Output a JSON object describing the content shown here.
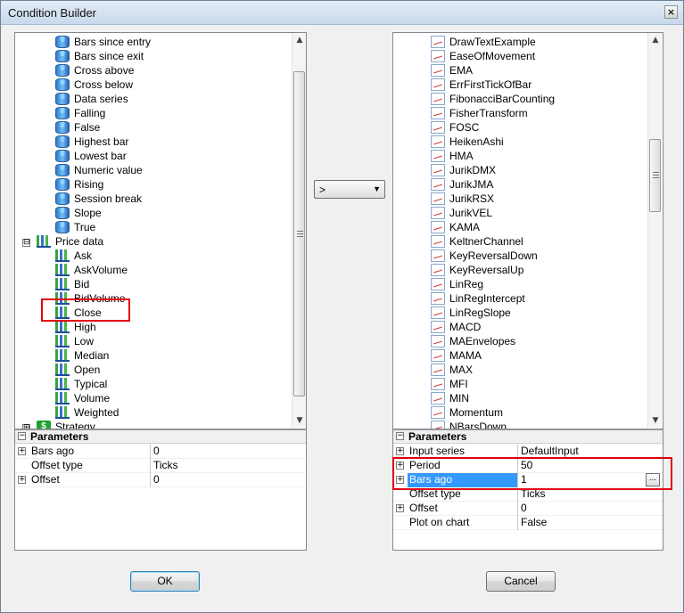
{
  "window": {
    "title": "Condition Builder",
    "close_label": "×"
  },
  "left_tree": {
    "items": [
      {
        "label": "Bars since entry",
        "icon": "cylinder-icon"
      },
      {
        "label": "Bars since exit",
        "icon": "cylinder-icon"
      },
      {
        "label": "Cross above",
        "icon": "cylinder-icon"
      },
      {
        "label": "Cross below",
        "icon": "cylinder-icon"
      },
      {
        "label": "Data series",
        "icon": "cylinder-icon"
      },
      {
        "label": "Falling",
        "icon": "cylinder-icon"
      },
      {
        "label": "False",
        "icon": "cylinder-icon"
      },
      {
        "label": "Highest bar",
        "icon": "cylinder-icon"
      },
      {
        "label": "Lowest bar",
        "icon": "cylinder-icon"
      },
      {
        "label": "Numeric value",
        "icon": "cylinder-icon"
      },
      {
        "label": "Rising",
        "icon": "cylinder-icon"
      },
      {
        "label": "Session break",
        "icon": "cylinder-icon"
      },
      {
        "label": "Slope",
        "icon": "cylinder-icon"
      },
      {
        "label": "True",
        "icon": "cylinder-icon"
      },
      {
        "label": "Price data",
        "icon": "price-data-icon",
        "expander": "⊟"
      },
      {
        "label": "Ask",
        "icon": "bar-chart-icon"
      },
      {
        "label": "AskVolume",
        "icon": "bar-chart-icon"
      },
      {
        "label": "Bid",
        "icon": "bar-chart-icon"
      },
      {
        "label": "BidVolume",
        "icon": "bar-chart-icon"
      },
      {
        "label": "Close",
        "icon": "bar-chart-icon"
      },
      {
        "label": "High",
        "icon": "bar-chart-icon"
      },
      {
        "label": "Low",
        "icon": "bar-chart-icon"
      },
      {
        "label": "Median",
        "icon": "bar-chart-icon"
      },
      {
        "label": "Open",
        "icon": "bar-chart-icon"
      },
      {
        "label": "Typical",
        "icon": "bar-chart-icon"
      },
      {
        "label": "Volume",
        "icon": "bar-chart-icon"
      },
      {
        "label": "Weighted",
        "icon": "bar-chart-icon"
      },
      {
        "label": "Strategy",
        "icon": "strategy-icon",
        "expander": "⊞"
      }
    ]
  },
  "left_params": {
    "header": "Parameters",
    "rows": [
      {
        "label": "Bars ago",
        "value": "0",
        "expander": "+"
      },
      {
        "label": "Offset type",
        "value": "Ticks",
        "expander": ""
      },
      {
        "label": "Offset",
        "value": "0",
        "expander": "+"
      }
    ]
  },
  "operator": {
    "value": ">",
    "arrow": "▼"
  },
  "right_list": {
    "items": [
      "DrawTextExample",
      "EaseOfMovement",
      "EMA",
      "ErrFirstTickOfBar",
      "FibonacciBarCounting",
      "FisherTransform",
      "FOSC",
      "HeikenAshi",
      "HMA",
      "JurikDMX",
      "JurikJMA",
      "JurikRSX",
      "JurikVEL",
      "KAMA",
      "KeltnerChannel",
      "KeyReversalDown",
      "KeyReversalUp",
      "LinReg",
      "LinRegIntercept",
      "LinRegSlope",
      "MACD",
      "MAEnvelopes",
      "MAMA",
      "MAX",
      "MFI",
      "MIN",
      "Momentum",
      "NBarsDown"
    ]
  },
  "right_params": {
    "header": "Parameters",
    "rows": [
      {
        "label": "Input series",
        "value": "DefaultInput",
        "expander": "+"
      },
      {
        "label": "Period",
        "value": "50",
        "expander": "+"
      },
      {
        "label": "Bars ago",
        "value": "1",
        "expander": "+",
        "button": "..."
      },
      {
        "label": "Offset type",
        "value": "Ticks",
        "expander": ""
      },
      {
        "label": "Offset",
        "value": "0",
        "expander": "+"
      },
      {
        "label": "Plot on chart",
        "value": "False",
        "expander": ""
      }
    ]
  },
  "buttons": {
    "ok": "OK",
    "cancel": "Cancel"
  },
  "colors": {
    "highlight_red": "#e2000f",
    "selection_blue": "#3399ff"
  }
}
